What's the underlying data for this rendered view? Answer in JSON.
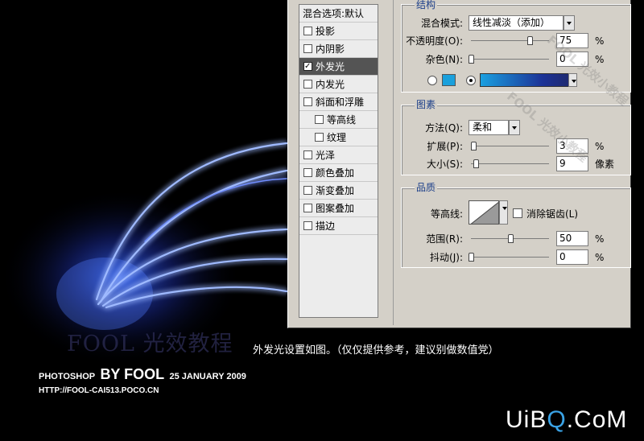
{
  "layer_style": {
    "list": [
      {
        "label": "混合选项:默认",
        "type": "header"
      },
      {
        "label": "投影",
        "checked": false
      },
      {
        "label": "内阴影",
        "checked": false
      },
      {
        "label": "外发光",
        "checked": true,
        "selected": true
      },
      {
        "label": "内发光",
        "checked": false
      },
      {
        "label": "斜面和浮雕",
        "checked": false
      },
      {
        "label": "等高线",
        "checked": false,
        "sub": true
      },
      {
        "label": "纹理",
        "checked": false,
        "sub": true
      },
      {
        "label": "光泽",
        "checked": false
      },
      {
        "label": "颜色叠加",
        "checked": false
      },
      {
        "label": "渐变叠加",
        "checked": false
      },
      {
        "label": "图案叠加",
        "checked": false
      },
      {
        "label": "描边",
        "checked": false
      }
    ],
    "structure": {
      "title": "结构",
      "blend_mode_label": "混合模式:",
      "blend_mode_value": "线性减淡（添加）",
      "opacity_label": "不透明度(O):",
      "opacity_value": "75",
      "opacity_unit": "%",
      "noise_label": "杂色(N):",
      "noise_value": "0",
      "noise_unit": "%",
      "color_swatch": "#1aa0dc",
      "color_selected": "gradient"
    },
    "elements": {
      "title": "图素",
      "technique_label": "方法(Q):",
      "technique_value": "柔和",
      "spread_label": "扩展(P):",
      "spread_value": "3",
      "spread_unit": "%",
      "size_label": "大小(S):",
      "size_value": "9",
      "size_unit": "像素"
    },
    "quality": {
      "title": "品质",
      "contour_label": "等高线:",
      "antialias_label": "消除锯齿(L)",
      "antialias_checked": false,
      "range_label": "范围(R):",
      "range_value": "50",
      "range_unit": "%",
      "jitter_label": "抖动(J):",
      "jitter_value": "0",
      "jitter_unit": "%"
    }
  },
  "caption": "外发光设置如图。（仅仅提供参考，建议别做数值党）",
  "watermark_text": "FOOL 光效教程",
  "credit": {
    "prefix": "PHOTOSHOP",
    "author": "BY FOOL",
    "date": "25 JANUARY 2009"
  },
  "url": "HTTP://FOOL-CAI513.POCO.CN",
  "logo": {
    "part1": "UiB",
    "part2": "Q",
    "part3": ".CoM"
  },
  "faint_watermark": "FOOL 光效小教程"
}
